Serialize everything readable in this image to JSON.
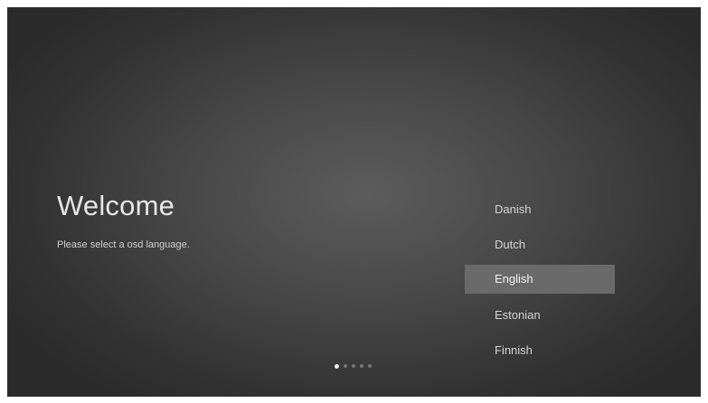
{
  "welcome": {
    "title": "Welcome",
    "subtitle": "Please select a osd language."
  },
  "languages": {
    "items": [
      {
        "label": "Danish"
      },
      {
        "label": "Dutch"
      },
      {
        "label": "English"
      },
      {
        "label": "Estonian"
      },
      {
        "label": "Finnish"
      }
    ],
    "selected_index": 2
  },
  "pager": {
    "total_pages": 5,
    "current_page": 1
  },
  "colors": {
    "background_center": "#5c5c5c",
    "background_edge": "#2b2b2b",
    "selection_highlight": "#6a6a6a",
    "text": "#d4d4d4"
  }
}
